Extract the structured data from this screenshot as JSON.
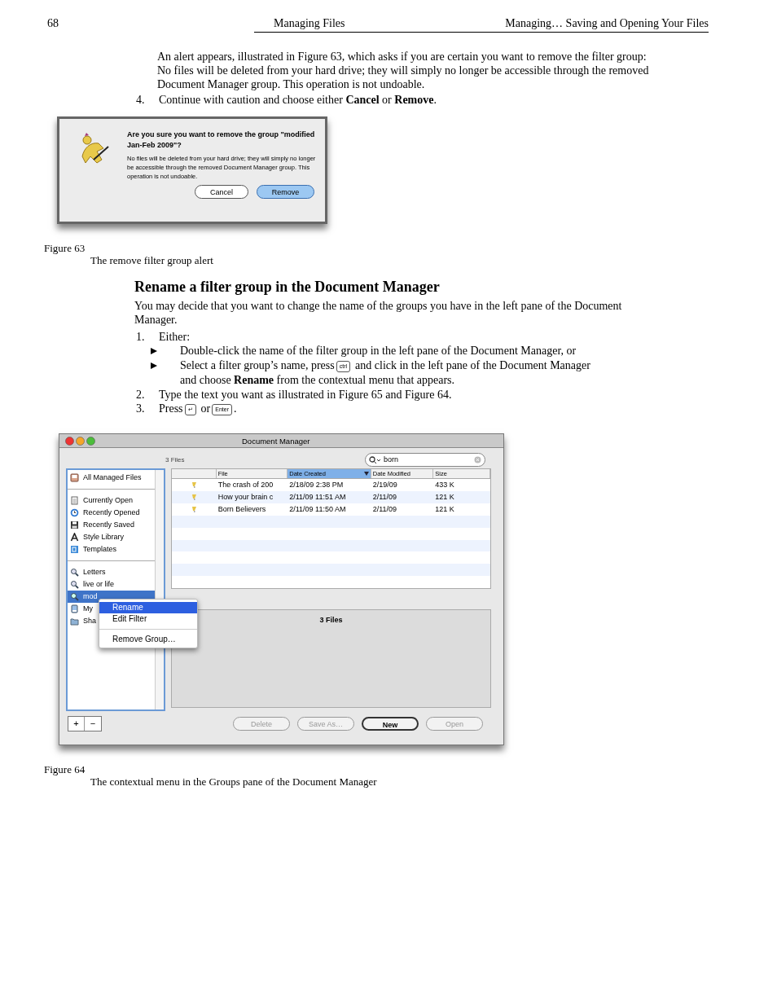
{
  "header": {
    "page_number": "68",
    "section": "Managing Files",
    "chapter": "Managing… Saving and Opening Your Files"
  },
  "intro": [
    "An alert appears, illustrated in Figure 63, which asks if you are certain you want to remove the filter group:",
    "No files will be deleted from your hard drive; they will simply no longer be accessible through the removed Document Manager group. This operation is not undoable."
  ],
  "step_4": {
    "number": "4.",
    "text": "Continue with caution and choose either **Cancel** or **Remove**."
  },
  "figure_63": {
    "alert": {
      "title": "Are you sure you want to remove the group \"modified Jan-Feb 2009\"?",
      "message": "No files will be deleted from your hard drive; they will simply no longer be accessible through the removed Document Manager group. This operation is not undoable.",
      "buttons": [
        {
          "label": "Cancel",
          "default": false
        },
        {
          "label": "Remove",
          "default": true
        }
      ]
    },
    "label": "Figure 63",
    "caption": "The remove filter group alert"
  },
  "section": {
    "heading": "Rename a filter group in the Document Manager",
    "paragraph": "You may decide that you want to change the name of the groups you have in the left pane of the Document Manager.",
    "steps": [
      {
        "number": "1.",
        "parts": [
          {
            "kind": "text",
            "text": "Either:"
          }
        ],
        "bullets": [
          [
            {
              "kind": "text",
              "text": "Double-click the name of the filter group in the left pane of the Document Manager, or"
            }
          ],
          [
            {
              "kind": "text",
              "text": "Select a filter group’s name, press"
            },
            {
              "kind": "key",
              "text": "ctrl"
            },
            {
              "kind": "text",
              "text": "and click in the left pane of the Document Manager"
            },
            {
              "kind": "text",
              "text": "and choose **Rename** from the contextual menu that appears.",
              "new_line": true
            }
          ]
        ]
      },
      {
        "number": "2.",
        "parts": [
          {
            "kind": "text",
            "text": "Type the text you want as illustrated in Figure 65 and Figure 64."
          }
        ]
      },
      {
        "number": "3.",
        "parts": [
          {
            "kind": "text",
            "text": "Press"
          },
          {
            "kind": "key",
            "text": "↵"
          },
          {
            "kind": "text",
            "text": "or"
          },
          {
            "kind": "key",
            "text": "Enter"
          },
          {
            "kind": "text",
            "text": "."
          }
        ]
      }
    ]
  },
  "figure_64": {
    "window": {
      "title": "Document Manager",
      "file_count": "3 Files",
      "search": {
        "value": "born"
      },
      "sidebar": {
        "groups": [
          {
            "items": [
              {
                "kind": "all",
                "label": "All Managed Files",
                "selected": false
              }
            ]
          },
          {
            "items": [
              {
                "kind": "document",
                "label": "Currently Open",
                "selected": false
              },
              {
                "kind": "clock",
                "label": "Recently Opened",
                "selected": false
              },
              {
                "kind": "disk",
                "label": "Recently Saved",
                "selected": false
              },
              {
                "kind": "style",
                "label": "Style Library",
                "selected": false
              },
              {
                "kind": "template",
                "label": "Templates",
                "selected": false
              }
            ]
          },
          {
            "items": [
              {
                "kind": "search",
                "label": "Letters",
                "selected": false
              },
              {
                "kind": "search",
                "label": "live or life",
                "selected": false
              },
              {
                "kind": "search",
                "label": "mod",
                "selected": true
              },
              {
                "kind": "drive",
                "label": "My",
                "selected": false
              },
              {
                "kind": "folder",
                "label": "Sha",
                "selected": false
              }
            ]
          }
        ]
      },
      "table": {
        "columns": [
          {
            "label": "File",
            "selected": false
          },
          {
            "label": "Date Created",
            "selected": true
          },
          {
            "label": "Date Modified",
            "selected": false
          },
          {
            "label": "Size",
            "selected": false
          }
        ],
        "rows": [
          [
            "The crash of 200",
            "2/18/09 2:38 PM",
            "2/19/09",
            "433 K"
          ],
          [
            "How your brain c",
            "2/11/09 11:51 AM",
            "2/11/09",
            "121 K"
          ],
          [
            "Born Believers",
            "2/11/09 11:50 AM",
            "2/11/09",
            "121 K"
          ]
        ]
      },
      "preview_title": "3 Files",
      "add_button": "+",
      "remove_button": "−",
      "buttons": [
        {
          "label": "Delete",
          "disabled": true,
          "default": false
        },
        {
          "label": "Save As…",
          "disabled": true,
          "default": false
        },
        {
          "label": "New",
          "disabled": false,
          "default": true
        },
        {
          "label": "Open",
          "disabled": true,
          "default": false
        }
      ],
      "context_menu": [
        {
          "kind": "item",
          "label": "Rename",
          "selected": true
        },
        {
          "kind": "item",
          "label": "Edit Filter",
          "selected": false
        },
        {
          "kind": "separator"
        },
        {
          "kind": "item",
          "label": "Remove Group…",
          "selected": false
        }
      ]
    },
    "label": "Figure 64",
    "caption": "The contextual menu in the Groups pane of the Document Manager"
  }
}
